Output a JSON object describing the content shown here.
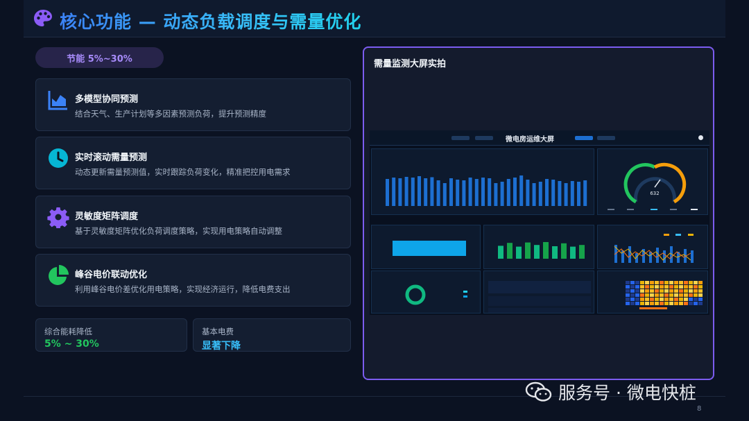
{
  "header": {
    "title": "核心功能 — 动态负载调度与需量优化",
    "icon": "palette-icon",
    "icon_color": "#8b5cf6"
  },
  "pill": {
    "label": "节能 5%~30%"
  },
  "features": [
    {
      "title": "多模型协同预测",
      "desc": "结合天气、生产计划等多因素预测负荷，提升预测精度",
      "icon": "area-chart-icon",
      "color": "#3b82f6"
    },
    {
      "title": "实时滚动需量预测",
      "desc": "动态更新需量预测值，实时跟踪负荷变化，精准把控用电需求",
      "icon": "clock-icon",
      "color": "#06b6d4"
    },
    {
      "title": "灵敏度矩阵调度",
      "desc": "基于灵敏度矩阵优化负荷调度策略，实现用电策略自动调整",
      "icon": "gear-icon",
      "color": "#8b5cf6"
    },
    {
      "title": "峰谷电价联动优化",
      "desc": "利用峰谷电价差优化用电策略，实现经济运行，降低电费支出",
      "icon": "pie-chart-icon",
      "color": "#22c55e"
    }
  ],
  "stats": [
    {
      "label": "综合能耗降低",
      "value": "5% ~ 30%"
    },
    {
      "label": "基本电费",
      "value": "显著下降"
    }
  ],
  "panel": {
    "title": "需量监测大屏实拍",
    "screenshot_title": "微电房运维大屏",
    "gauge_value": "632",
    "bar_values": [
      78,
      82,
      80,
      84,
      82,
      86,
      80,
      83,
      74,
      66,
      80,
      76,
      74,
      82,
      78,
      82,
      80,
      66,
      70,
      78,
      82,
      88,
      76,
      66,
      70,
      78,
      76,
      72,
      66,
      72,
      70,
      74
    ],
    "green_bars": [
      62,
      76,
      58,
      78,
      66,
      80,
      60,
      74,
      58,
      66
    ]
  },
  "watermark": {
    "text": "服务号 · 微电快桩"
  },
  "page_number": "8"
}
